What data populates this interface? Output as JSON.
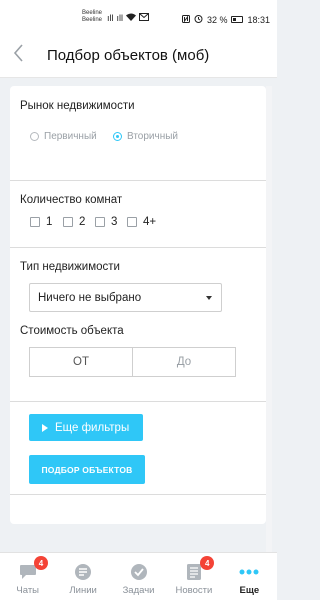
{
  "status_bar": {
    "carrier_1": "Beeline",
    "carrier_2": "Beeline",
    "signal_1": "ıll",
    "signal_2": "ıll",
    "battery_percent": "32 %",
    "time": "18:31"
  },
  "header": {
    "back_icon": "chevron-left-icon",
    "title": "Подбор объектов (моб)"
  },
  "form": {
    "market": {
      "label": "Рынок недвижимости",
      "options": [
        {
          "label": "Первичный",
          "selected": false
        },
        {
          "label": "Вторичный",
          "selected": true
        }
      ]
    },
    "rooms": {
      "label": "Количество комнат",
      "options": [
        "1",
        "2",
        "3",
        "4+"
      ]
    },
    "property_type": {
      "label": "Тип недвижимости",
      "value": "Ничего не выбрано"
    },
    "price": {
      "label": "Стоимость объекта",
      "from_placeholder": "ОТ",
      "to_placeholder": "До"
    },
    "more_filters_button": "Еще фильтры",
    "submit_button": "ПОДБОР ОБЪЕКТОВ"
  },
  "colors": {
    "accent": "#2fc7f7",
    "badge": "#f44336"
  },
  "tabbar": {
    "tabs": [
      {
        "label": "Чаты",
        "icon": "chat-icon",
        "badge": "4"
      },
      {
        "label": "Линии",
        "icon": "lines-icon",
        "badge": ""
      },
      {
        "label": "Задачи",
        "icon": "check-icon",
        "badge": ""
      },
      {
        "label": "Новости",
        "icon": "news-icon",
        "badge": "4"
      },
      {
        "label": "Еще",
        "icon": "more-icon",
        "badge": "",
        "active": true
      }
    ]
  }
}
